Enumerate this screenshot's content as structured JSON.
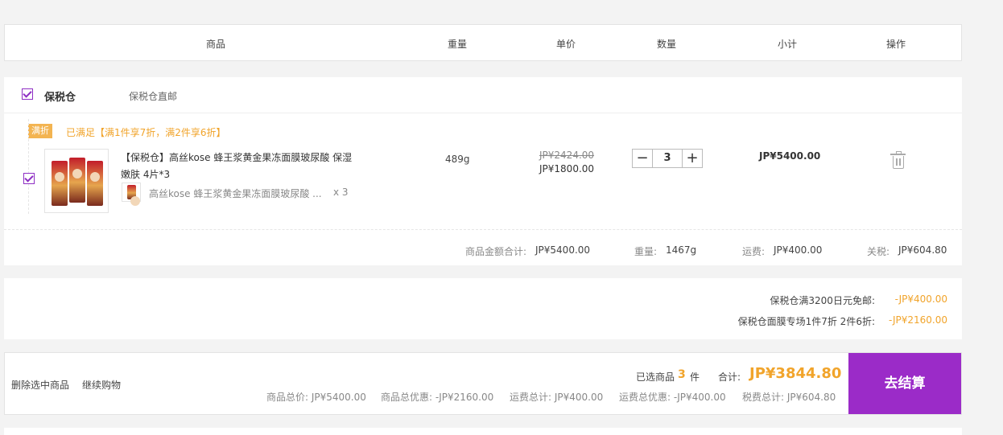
{
  "header": {
    "col_product": "商品",
    "col_weight": "重量",
    "col_unit_price": "单价",
    "col_quantity": "数量",
    "col_subtotal": "小计",
    "col_action": "操作"
  },
  "warehouse": {
    "name": "保税仓",
    "shipping_note": "保税仓直邮",
    "promo_badge": "满折",
    "promo_text": "已满足【满1件享7折，满2件享6折】",
    "item": {
      "title_line1": "【保税仓】高丝kose 蜂王浆黄金果冻面膜玻尿酸 保湿",
      "title_line2": "嫩肤 4片*3",
      "sub_title": "高丝kose 蜂王浆黄金果冻面膜玻尿酸 ...",
      "sub_qty": "x 3",
      "weight": "489g",
      "original_price": "JP¥2424.00",
      "price": "JP¥1800.00",
      "quantity": "3",
      "minus": "−",
      "plus": "+",
      "subtotal": "JP¥5400.00"
    },
    "summary": {
      "goods_total_label": "商品金额合计:",
      "goods_total": "JP¥5400.00",
      "weight_label": "重量:",
      "weight": "1467g",
      "shipping_label": "运费:",
      "shipping": "JP¥400.00",
      "tax_label": "关税:",
      "tax": "JP¥604.80"
    }
  },
  "discounts": [
    {
      "label": "保税仓满3200日元免邮:",
      "value": "-JP¥400.00"
    },
    {
      "label": "保税仓面膜专场1件7折 2件6折:",
      "value": "-JP¥2160.00"
    }
  ],
  "bottom_bar": {
    "delete_selected": "删除选中商品",
    "continue_shopping": "继续购物",
    "selected_prefix": "已选商品",
    "selected_count": "3",
    "selected_suffix": "件",
    "total_label": "合计:",
    "total": "JP¥3844.80",
    "goods_total": "商品总价: JP¥5400.00",
    "goods_discount": "商品总优惠: -JP¥2160.00",
    "shipping_total": "运费总计: JP¥400.00",
    "shipping_discount": "运费总优惠: -JP¥400.00",
    "tax_total": "税费总计: JP¥604.80",
    "checkout": "去结算"
  },
  "colors": {
    "accent": "#9b2bc8",
    "promo": "#f1a42b"
  }
}
